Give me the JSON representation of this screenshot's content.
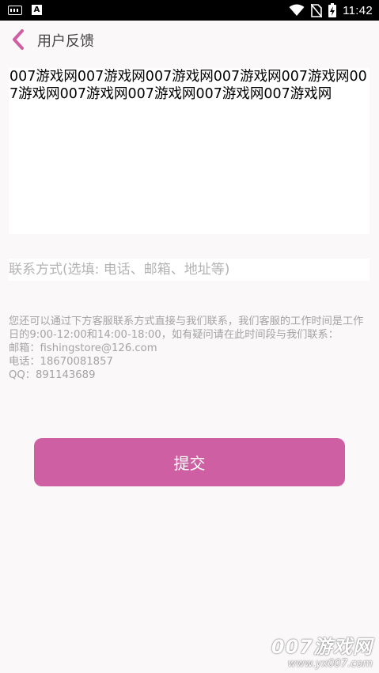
{
  "status_bar": {
    "time": "11:42",
    "icons": [
      "keyboard-icon",
      "a-notification-icon",
      "wifi-icon",
      "no-sim-icon",
      "battery-charging-icon"
    ]
  },
  "header": {
    "title": "用户反馈",
    "back_icon": "chevron-left-icon",
    "accent_color": "#cf5fa3"
  },
  "feedback": {
    "value": "007游戏网007游戏网007游戏网007游戏网007游戏网007游戏网007游戏网007游戏网007游戏网007游戏网"
  },
  "contact": {
    "placeholder": "联系方式(选填: 电话、邮箱、地址等)",
    "value": ""
  },
  "info": {
    "description": "您还可以通过下方客服联系方式直接与我们联系，我们客服的工作时间是工作日的9:00-12:00和14:00-18:00，如有疑问请在此时间段与我们联系：",
    "email": "邮箱：fishingstore@126.com",
    "phone": "电话：18670081857",
    "qq": "QQ：891143689"
  },
  "submit": {
    "label": "提交",
    "color": "#cf5fa3"
  },
  "watermark": {
    "brand": "007游戏网",
    "url": "www.yx007.com"
  }
}
